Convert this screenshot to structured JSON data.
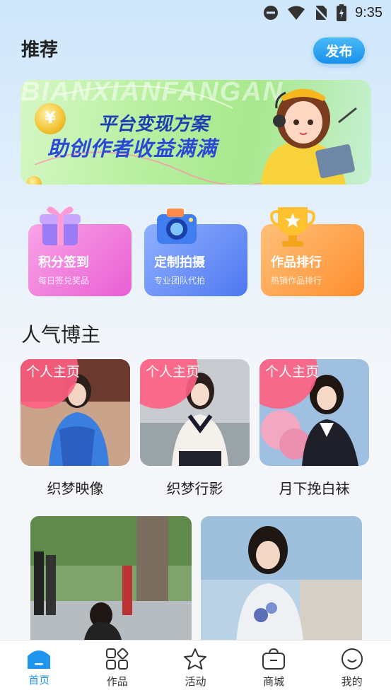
{
  "status_bar": {
    "time": "9:35",
    "icons": [
      "do-not-disturb-icon",
      "wifi-icon",
      "no-sim-icon",
      "battery-charging-icon"
    ]
  },
  "header": {
    "title": "推荐",
    "publish_label": "发布"
  },
  "banner": {
    "watermark": "BIANXIANFANGAN",
    "line1": "平台变现方案",
    "line2": "助创作者收益满满",
    "coin_symbol": "¥"
  },
  "features": [
    {
      "title": "积分签到",
      "subtitle": "每日签兑奖品",
      "icon": "gift-box-icon"
    },
    {
      "title": "定制拍摄",
      "subtitle": "专业团队代拍",
      "icon": "camera-icon"
    },
    {
      "title": "作品排行",
      "subtitle": "热销作品排行",
      "icon": "trophy-icon"
    }
  ],
  "section": {
    "title": "人气博主"
  },
  "bloggers": [
    {
      "tag": "个人主页",
      "name": "织梦映像"
    },
    {
      "tag": "个人主页",
      "name": "织梦行影"
    },
    {
      "tag": "个人主页",
      "name": "月下挽白袜"
    }
  ],
  "bottom_nav": [
    {
      "label": "首页",
      "icon": "home-icon",
      "active": true
    },
    {
      "label": "作品",
      "icon": "works-grid-icon",
      "active": false
    },
    {
      "label": "活动",
      "icon": "star-icon",
      "active": false
    },
    {
      "label": "商城",
      "icon": "shopping-bag-icon",
      "active": false
    },
    {
      "label": "我的",
      "icon": "profile-smile-icon",
      "active": false
    }
  ],
  "colors": {
    "accent": "#1f95f0",
    "feature_pink": "#f06fd8",
    "feature_blue": "#5b84f5",
    "feature_orange": "#ff9a3c",
    "tag_pink": "#ff5f82"
  }
}
